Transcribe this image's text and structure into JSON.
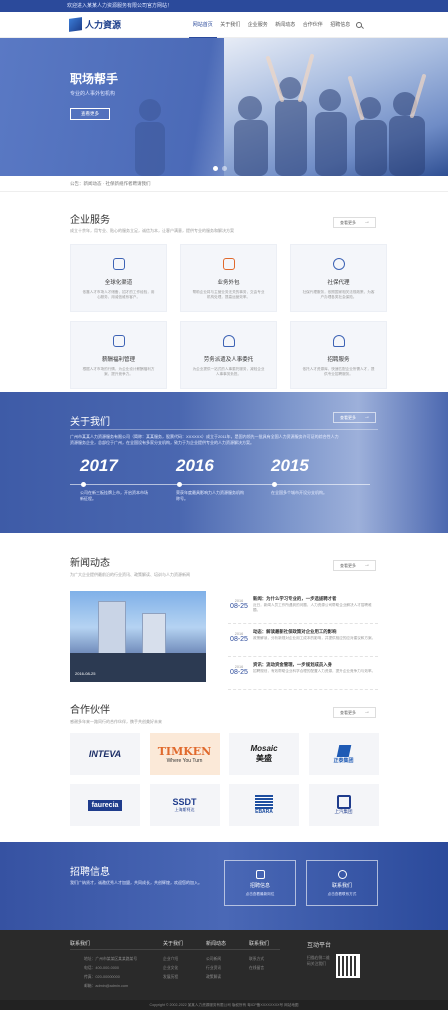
{
  "topbar": {
    "text": "欢迎进入某某人力资源服务有限公司官方网站！"
  },
  "header": {
    "logo_text": "人力資源",
    "nav": [
      "网站首页",
      "关于我们",
      "企业服务",
      "新闻动态",
      "合作伙伴",
      "招聘信息",
      "联系我们"
    ],
    "active_index": 0
  },
  "hero": {
    "title": "职场帮手",
    "subtitle": "专业的人事外包机构",
    "button": "查看更多"
  },
  "breadcrumb": "公告：新闻动态 · 社保新规作者聘请我们",
  "services": {
    "title": "企业服务",
    "subtitle": "成立十余年，用专业、贴心的服务立足，诚信为本，让客户满意，提供专业的服务和解决方案",
    "more": "查看更多",
    "items": [
      {
        "title": "全球化渠道",
        "desc": "依靠人才市场人才储备，招才的工作经验，用心服务，用诚信维系客户。"
      },
      {
        "title": "业务外包",
        "desc": "帮助企业将与主营业务无关的事务，交由专业机构处理，提高运营效率。"
      },
      {
        "title": "社保代理",
        "desc": "社保代理服务，依照国家相关法规政策，为客户办理各类社会保险。"
      },
      {
        "title": "薪酬福利管理",
        "desc": "根据人才市场的行情，为企业设计薪酬福利方案，提升竞争力。"
      },
      {
        "title": "劳务派遣及人事委托",
        "desc": "为企业提供一站式的人事委托服务，减轻企业人事事务负担。"
      },
      {
        "title": "招聘服务",
        "desc": "依托人才资源库，快速匹配企业所需人才，提供专业招聘服务。"
      }
    ]
  },
  "about": {
    "title": "关于我们",
    "more": "查看更多",
    "text": "广州市某某人力资源服务有限公司（简称：某某服务，股票代码：XXXXXX）成立于2011年，是国内领先一批具有全国人力资源服务许可证的综合性人力资源服务企业，总部位于广州，在全国设有多家分支机构，致力于为企业提供专业的人力资源解决方案。",
    "milestones": [
      {
        "year": "2017",
        "desc": "公司在新三板挂牌上市，开启资本市场新征程。"
      },
      {
        "year": "2016",
        "desc": "荣获年度最具影响力人力资源服务机构称号。"
      },
      {
        "year": "2015",
        "desc": "在全国多个城市开设分支机构。"
      }
    ]
  },
  "news": {
    "title": "新闻动态",
    "subtitle": "为广大企业提供最前沿的行业资讯、政策解读、培训与人力资源新闻",
    "more": "查看更多",
    "image_caption": "2016-08-25",
    "items": [
      {
        "day": "2016",
        "md": "08-25",
        "title": "新闻：为什么学习专业的，一步选拔聘才者",
        "desc": "近日，新闻人员工作所遇到的问题，人力资源公司帮助企业解决人才招聘难题。"
      },
      {
        "day": "2016",
        "md": "08-25",
        "title": "动态：解读最新社保政策对企业用工的影响",
        "desc": "政策解读，分析新规对企业用工成本的影响，并提供相应的应对建议和方案。"
      },
      {
        "day": "2016",
        "md": "08-25",
        "title": "资讯：流动资金管理，一步规划成员入身",
        "desc": "招聘规划，有效帮助企业科学合理的配置人力资源，提升企业竞争力与效率。"
      }
    ]
  },
  "partners": {
    "title": "合作伙伴",
    "subtitle": "感谢多年来一路同行的合作伙伴，携手共创美好未来",
    "more": "查看更多",
    "logos": [
      {
        "name": "INTEVA",
        "color": "#1b2d66"
      },
      {
        "name": "TIMKEN",
        "sub": "Where You Turn",
        "color": "#e0692c"
      },
      {
        "name": "Mosaic",
        "sub": "美盛",
        "color": "#1a1a1a"
      },
      {
        "name": "正泰集团",
        "color": "#1f5bb5"
      },
      {
        "name": "faurecia",
        "color": "#1f3c8c"
      },
      {
        "name": "SSDT",
        "sub": "上海斯柯达",
        "color": "#1f3c8c"
      },
      {
        "name": "EBARA",
        "color": "#1f4fa0"
      },
      {
        "name": "上汽集团",
        "color": "#1f3c8c"
      }
    ]
  },
  "recruit": {
    "title": "招聘信息",
    "desc": "我们广纳贤才，诚邀优秀人才加盟，共同成长，共创辉煌，欢迎您的加入。",
    "boxes": [
      {
        "title": "招聘信息",
        "sub": "点击查看最新岗位"
      },
      {
        "title": "联系我们",
        "sub": "点击查看联系方式"
      }
    ]
  },
  "footer": {
    "contact_title": "联系我们",
    "contact_lines": [
      "地址：广州市某某区某某路某号",
      "电话：400-000-0000",
      "传真：020-00000000",
      "邮箱：admin@admin.com"
    ],
    "col2_title": "关于我们",
    "col2": [
      "企业介绍",
      "企业文化",
      "发展历程"
    ],
    "col3_title": "新闻动态",
    "col3": [
      "公司新闻",
      "行业资讯",
      "政策解读"
    ],
    "col4_title": "联系我们",
    "col4": [
      "联系方式",
      "在线留言"
    ],
    "interact_title": "互动平台",
    "interact_text": "扫描右侧二维码关注我们",
    "copyright": "Copyright © 2002-2022 某某人力资源服务有限公司 版权所有 粤ICP备XXXXXXXX号 网站地图"
  }
}
